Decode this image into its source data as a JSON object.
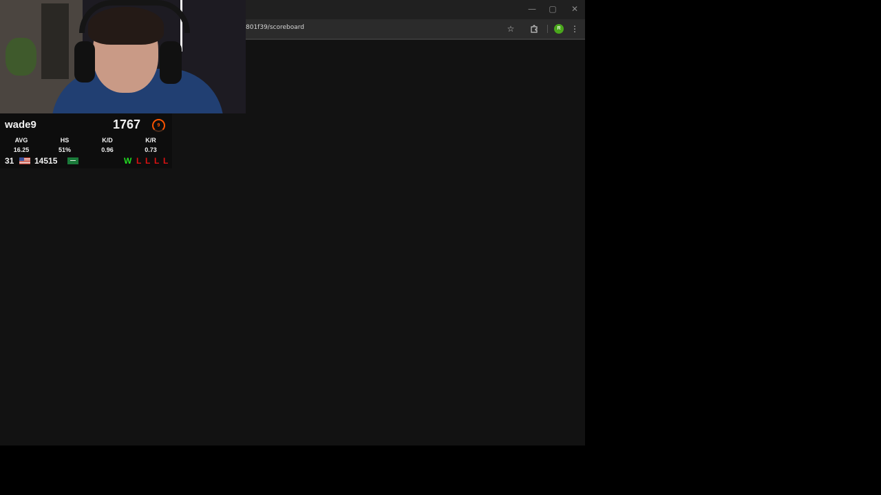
{
  "browser": {
    "url": "801f39/scoreboard",
    "profile_initial": "R",
    "window_controls": {
      "minimize": "—",
      "maximize": "▢",
      "close": "✕"
    },
    "icons": {
      "bookmark": "star-icon",
      "extensions": "puzzle-icon",
      "menu": "kebab-menu-icon"
    }
  },
  "overlay": {
    "player": "wade9",
    "elo": "1767",
    "level": "9",
    "level_color": "#ff5500",
    "stats": [
      {
        "label": "AVG",
        "value": "16.25"
      },
      {
        "label": "HS",
        "value": "51%"
      },
      {
        "label": "K/D",
        "value": "0.96"
      },
      {
        "label": "K/R",
        "value": "0.73"
      }
    ],
    "rank_country": "31",
    "rank_region": "14515",
    "recent_results": [
      "W",
      "L",
      "L",
      "L",
      "L"
    ],
    "win_color": "#22dd22",
    "loss_color": "#dd1111"
  }
}
